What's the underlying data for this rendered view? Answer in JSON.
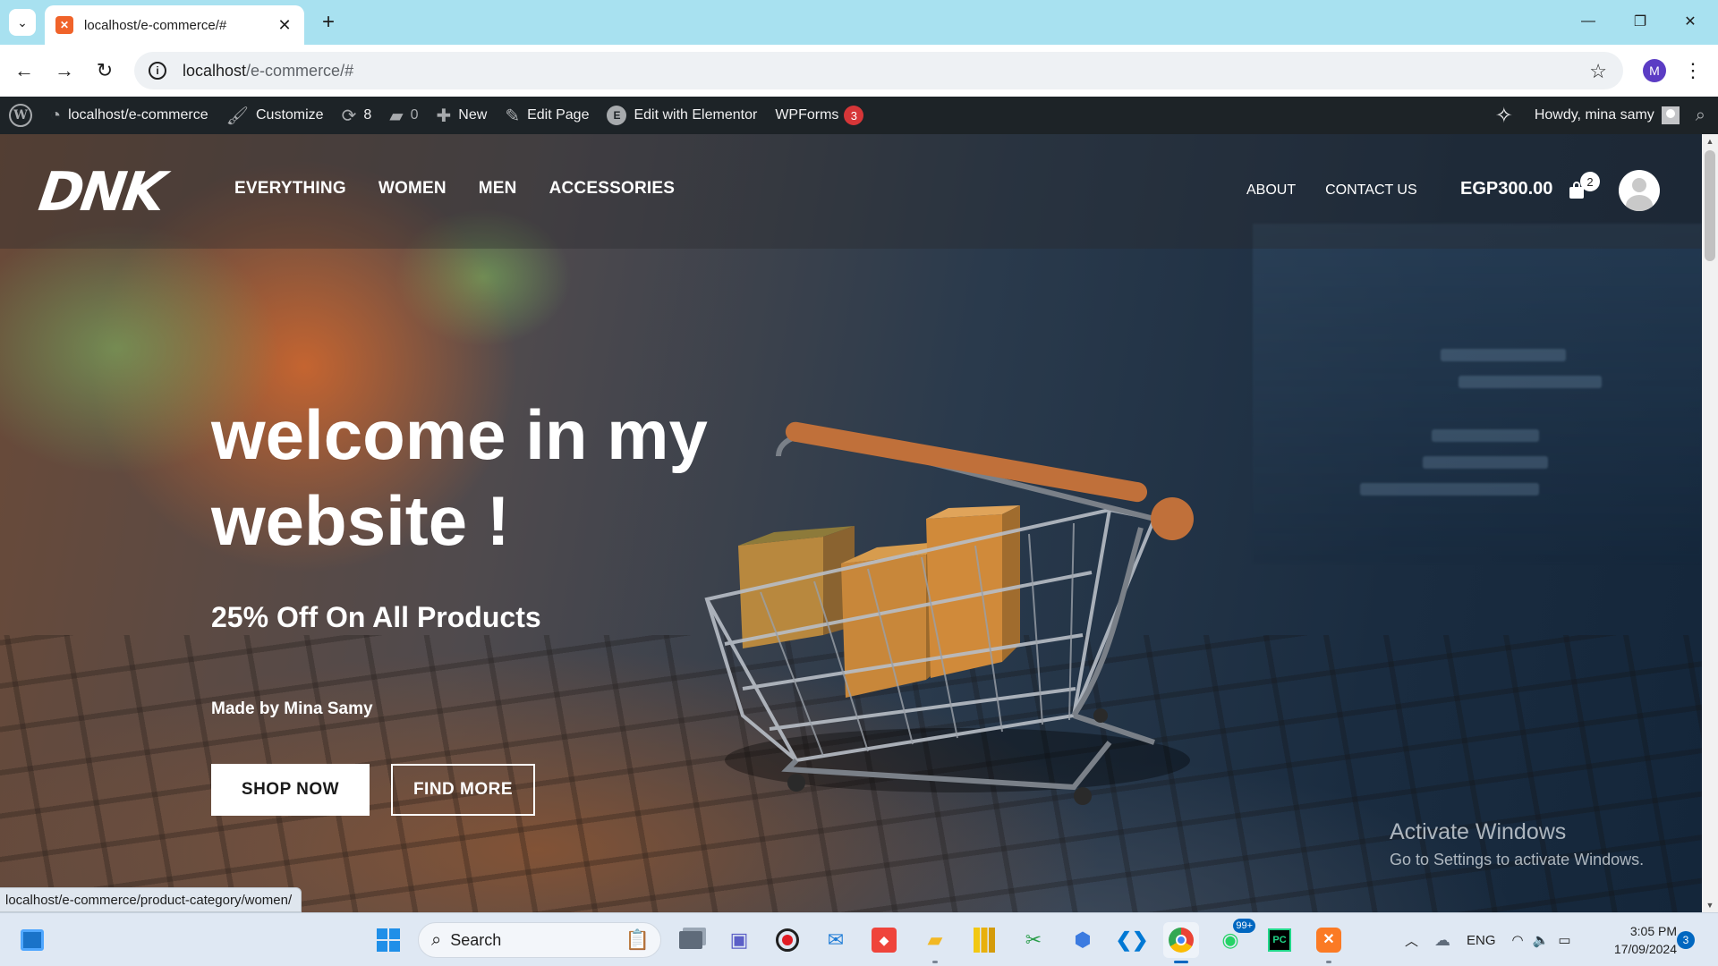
{
  "browser": {
    "tab_title": "localhost/e-commerce/#",
    "url_host": "localhost",
    "url_path": "/e-commerce/#",
    "profile_initial": "M",
    "status_url": "localhost/e-commerce/product-category/women/"
  },
  "admin_bar": {
    "site_name": "localhost/e-commerce",
    "customize": "Customize",
    "updates_count": "8",
    "comments_count": "0",
    "new_label": "New",
    "edit_page": "Edit Page",
    "edit_elementor": "Edit with Elementor",
    "wpforms": "WPForms",
    "wpforms_badge": "3",
    "howdy": "Howdy, mina samy"
  },
  "site": {
    "logo": "DNK",
    "main_nav": [
      "EVERYTHING",
      "WOMEN",
      "MEN",
      "ACCESSORIES"
    ],
    "secondary_nav": [
      "ABOUT",
      "CONTACT US"
    ],
    "cart_total": "EGP300.00",
    "cart_count": "2"
  },
  "hero": {
    "title": "welcome in my website !",
    "subtitle": "25% Off On All Products",
    "credit": "Made by Mina Samy",
    "primary_button": "SHOP NOW",
    "secondary_button": "FIND MORE"
  },
  "watermark": {
    "line1": "Activate Windows",
    "line2": "Go to Settings to activate Windows."
  },
  "taskbar": {
    "search_label": "Search",
    "whatsapp_badge": "99+",
    "language": "ENG",
    "time": "3:05 PM",
    "date": "17/09/2024",
    "notification_count": "3"
  },
  "colors": {
    "browser_tabbar": "#a8e1f0",
    "wp_adminbar": "#1d2327",
    "badge_red": "#d63638",
    "taskbar": "#dfe8f3"
  }
}
